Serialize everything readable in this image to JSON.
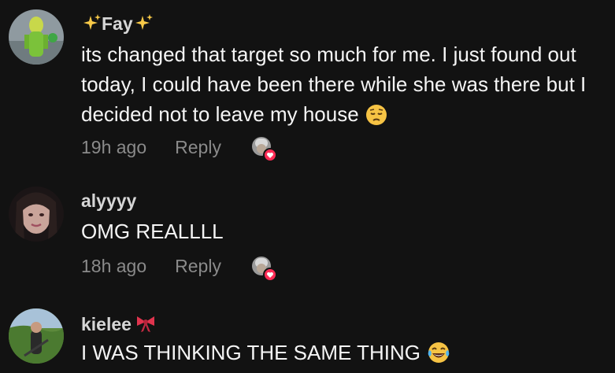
{
  "comments": [
    {
      "username": "Fay",
      "text": "its changed that target so much for me. I just found out today, I could have been there while she was there but I decided not to leave my house",
      "time": "19h ago",
      "reply_label": "Reply",
      "emoji": "pensive-face",
      "username_decoration": "sparkles"
    },
    {
      "username": "alyyyy",
      "text": "OMG REALLLL",
      "time": "18h ago",
      "reply_label": "Reply"
    },
    {
      "username": "kielee",
      "text": "I WAS THINKING THE SAME THING",
      "emoji": "laughing-tears-face",
      "username_decoration": "ribbon"
    }
  ],
  "colors": {
    "background": "#121212",
    "heart_badge": "#fe2c55",
    "meta_text": "#8a8a8a"
  }
}
